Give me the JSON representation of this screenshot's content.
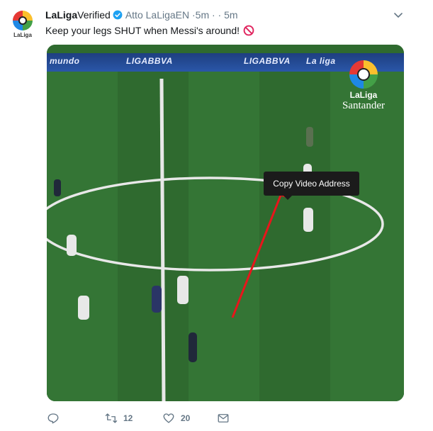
{
  "tweet": {
    "author_name": "LaLiga",
    "verified_label": "Verified",
    "handle_text": "Atto LaLigaEN ·5m · · 5m",
    "text": "Keep your legs SHUT when Messi's around!",
    "avatar_label": "LaLiga"
  },
  "media": {
    "banner_labels": [
      "mundo",
      "LIGABBVA",
      "LIGABBVA",
      "La liga"
    ],
    "logo_brand": "LaLiga",
    "logo_sponsor": "Santander",
    "tooltip_text": "Copy Video Address"
  },
  "actions": {
    "reply_count": "",
    "retweet_count": "12",
    "like_count": "20"
  },
  "colors": {
    "verified": "#1da1f2",
    "pitch": "#2f6a2f",
    "arrow": "#e8151b",
    "muted": "#657786"
  },
  "icons": [
    "verified-icon",
    "chevron-down-icon",
    "prohibited-icon",
    "reply-icon",
    "retweet-icon",
    "heart-icon",
    "message-icon"
  ]
}
